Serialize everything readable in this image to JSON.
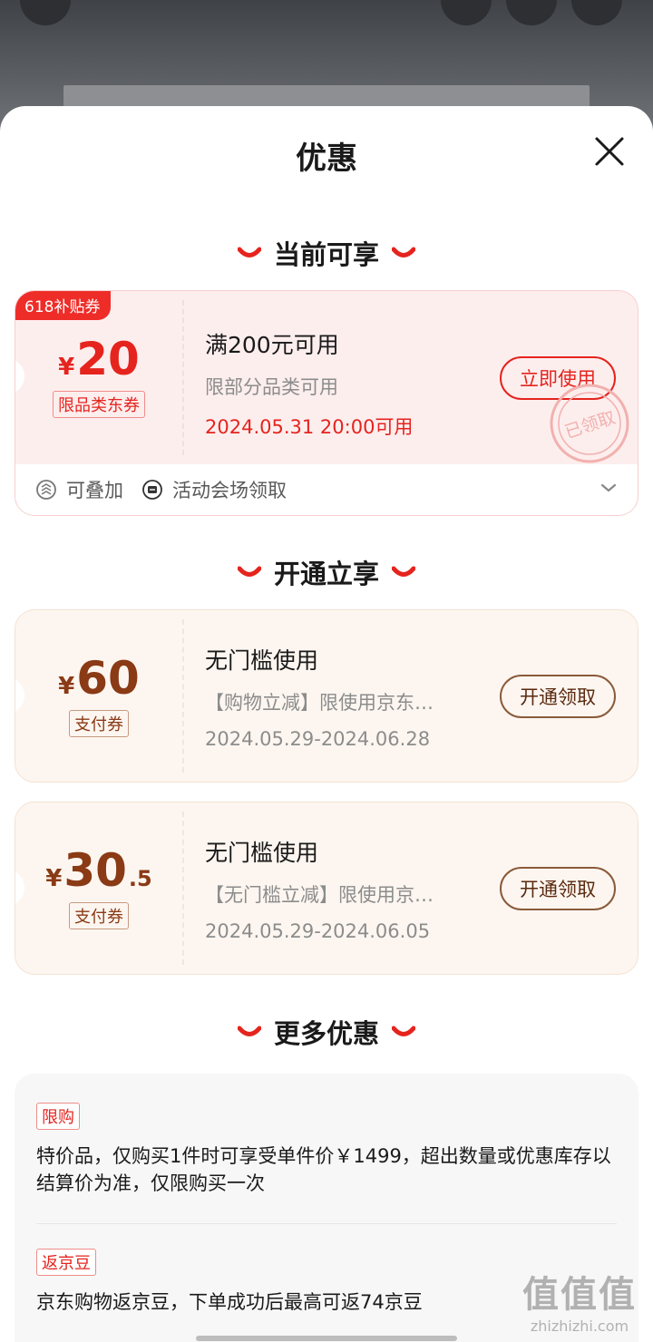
{
  "sheet": {
    "title": "优惠"
  },
  "sections": {
    "current": "当前可享",
    "activate": "开通立享",
    "more": "更多优惠"
  },
  "coupon_current": {
    "badge": "618补贴券",
    "currency": "¥",
    "amount": "20",
    "type_tag": "限品类东券",
    "condition": "满200元可用",
    "scope": "限部分品类可用",
    "time": "2024.05.31 20:00可用",
    "action": "立即使用",
    "stamp_text": "已领取",
    "footer": {
      "stackable": "可叠加",
      "source": "活动会场领取"
    }
  },
  "coupons_activate": [
    {
      "currency": "¥",
      "amount": "60",
      "decimal": "",
      "type_tag": "支付券",
      "condition": "无门槛使用",
      "scope": "【购物立减】限使用京东…",
      "validity": "2024.05.29-2024.06.28",
      "action": "开通领取"
    },
    {
      "currency": "¥",
      "amount": "30",
      "decimal": ".5",
      "type_tag": "支付券",
      "condition": "无门槛使用",
      "scope": "【无门槛立减】限使用京…",
      "validity": "2024.05.29-2024.06.05",
      "action": "开通领取"
    }
  ],
  "more_offers": [
    {
      "tag": "限购",
      "text": "特价品，仅购买1件时可享受单件价￥1499，超出数量或优惠库存以结算价为准，仅限购买一次"
    },
    {
      "tag": "返京豆",
      "text": "京东购物返京豆，下单成功后最高可返74京豆"
    }
  ],
  "watermark": {
    "line1": "值值值",
    "line2": "zhizhizhi.com"
  },
  "icons": [
    "close-icon",
    "smile-icon",
    "stack-icon",
    "ticket-icon",
    "chevron-down-icon"
  ],
  "colors": {
    "accent_red": "#e5241e",
    "brown": "#8a3a15"
  }
}
